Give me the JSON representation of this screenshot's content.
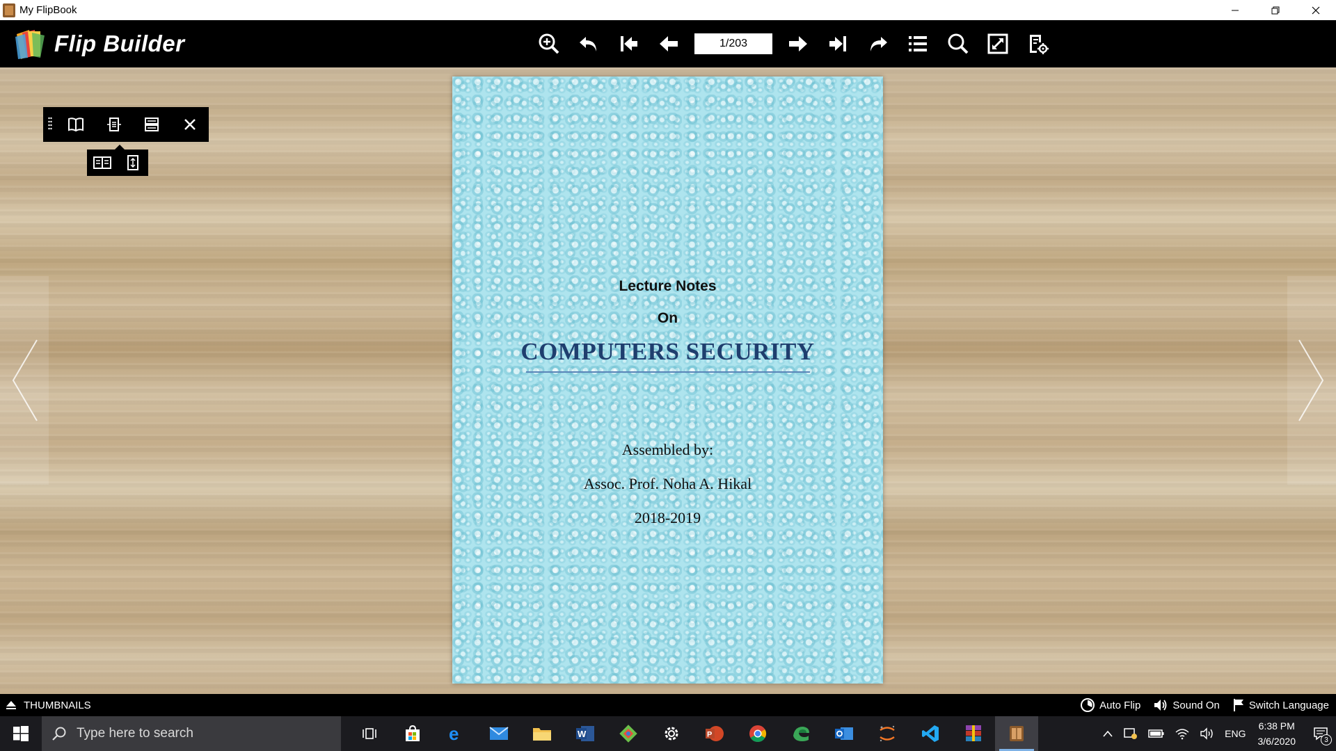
{
  "window": {
    "title": "My FlipBook",
    "controls": {
      "minimize_icon": "minimize-icon",
      "restore_icon": "restore-icon",
      "close_icon": "close-icon"
    }
  },
  "toolbar": {
    "brand_name": "Flip Builder",
    "page_indicator": "1/203",
    "tools": [
      "zoom-in-icon",
      "undo-icon",
      "first-page-icon",
      "previous-page-icon",
      "next-page-icon",
      "last-page-icon",
      "redo-icon",
      "table-of-contents-icon",
      "search-icon",
      "fullscreen-icon",
      "settings-icon"
    ]
  },
  "mini_toolbar": {
    "buttons": [
      "book-view-icon",
      "single-page-icon",
      "scroll-view-icon",
      "close-icon"
    ],
    "sub_buttons": [
      "double-page-icon",
      "fit-height-icon"
    ]
  },
  "book_page": {
    "line1": "Lecture Notes",
    "line2": "On",
    "title": "COMPUTERS SECURITY",
    "assembled_by": "Assembled by:",
    "author": "Assoc. Prof. Noha A. Hikal",
    "year": "2018-2019",
    "background_color": "#aee4ee",
    "title_color": "#1f3e6e"
  },
  "bottom_bar": {
    "thumbnails_label": "THUMBNAILS",
    "auto_flip_label": "Auto Flip",
    "sound_label": "Sound On",
    "language_label": "Switch Language"
  },
  "taskbar": {
    "search_placeholder": "Type here to search",
    "apps": [
      "task-view-icon",
      "store-icon",
      "edge-icon",
      "mail-icon",
      "file-explorer-icon",
      "word-icon",
      "git-icon",
      "settings-icon",
      "powerpoint-icon",
      "chrome-icon",
      "edge-dev-icon",
      "outlook-icon",
      "jupyter-icon",
      "vscode-icon",
      "winrar-icon",
      "flipbook-icon"
    ],
    "tray": {
      "language": "ENG",
      "time": "6:38 PM",
      "date": "3/6/2020",
      "notification_count": "3"
    }
  }
}
